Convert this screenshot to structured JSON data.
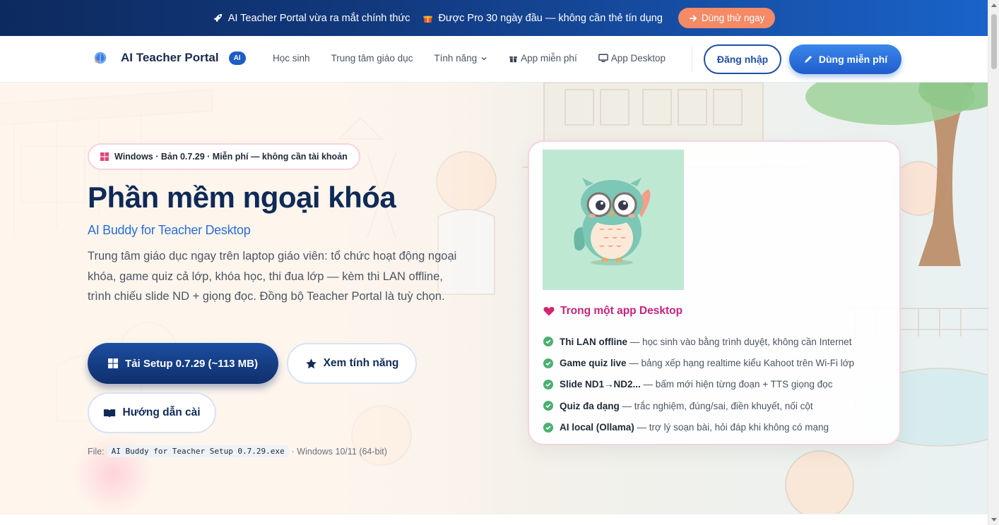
{
  "announce": {
    "launch_text": "AI Teacher Portal vừa ra mắt chính thức",
    "promo_text": "Được Pro 30 ngày đầu — không cần thẻ tín dụng",
    "cta_label": "Dùng thử ngay"
  },
  "nav": {
    "brand_name": "AI Teacher Portal",
    "brand_badge": "AI",
    "links": [
      "Học sinh",
      "Trung tâm giáo dục",
      "Tính năng",
      "App miễn phí",
      "App Desktop"
    ],
    "login_label": "Đăng nhập",
    "free_label": "Dùng miễn phí"
  },
  "hero": {
    "pill_text": "Windows · Bản 0.7.29 · Miễn phí — không cần tài khoản",
    "title": "Phần mềm ngoại khóa",
    "subtitle": "AI Buddy for Teacher Desktop",
    "description": "Trung tâm giáo dục ngay trên laptop giáo viên: tổ chức hoạt động ngoại khóa, game quiz cả lớp, khóa học, thi đua lớp — kèm thi LAN offline, trình chiếu slide ND + giọng đọc. Đồng bộ Teacher Portal là tuỳ chọn.",
    "setup_label": "Tải Setup 0.7.29 (~113 MB)",
    "features_label": "Xem tính năng",
    "guide_label": "Hướng dẫn cài",
    "file_label": "File:",
    "file_name": "AI Buddy for Teacher Setup 0.7.29.exe",
    "file_os": "· Windows 10/11 (64-bit)"
  },
  "card": {
    "title": "Trong một app Desktop",
    "items": [
      {
        "bold": "Thi LAN offline",
        "text": " — học sinh vào bằng trình duyệt, không cần Internet"
      },
      {
        "bold": "Game quiz live",
        "text": " — bảng xếp hạng realtime kiểu Kahoot trên Wi-Fi lớp"
      },
      {
        "bold": "Slide ND1→ND2...",
        "text": " — bấm mới hiện từng đoạn + TTS giọng đọc"
      },
      {
        "bold": "Quiz đa dạng",
        "text": " — trắc nghiệm, đúng/sai, điền khuyết, nối cột"
      },
      {
        "bold": "AI local (Ollama)",
        "text": " — trợ lý soạn bài, hỏi đáp khi không có mạng"
      }
    ]
  },
  "colors": {
    "brand_navy": "#0f2a57",
    "brand_blue": "#1f5dcc",
    "accent_pink": "#c4247d",
    "cta_orange": "#f48a66",
    "check_green": "#4caf73"
  },
  "icons": [
    "rocket-icon",
    "gift-icon",
    "arrow-right-icon",
    "brain-logo-icon",
    "chevron-down-icon",
    "gift-icon",
    "monitor-icon",
    "pencil-icon",
    "windows-icon",
    "star-icon",
    "book-icon",
    "heart-icon",
    "check-circle-icon"
  ]
}
